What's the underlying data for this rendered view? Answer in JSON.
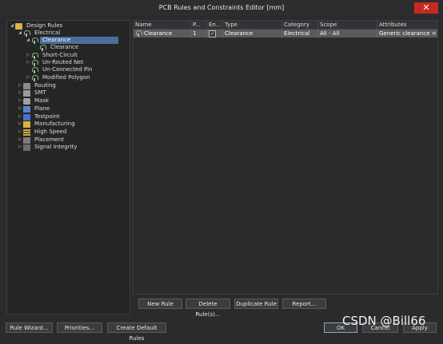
{
  "window": {
    "title": "PCB Rules and Constraints Editor [mm]",
    "close_glyph": "✕"
  },
  "tree": {
    "items": [
      {
        "label": "Design Rules",
        "arrow": "◢"
      },
      {
        "label": "Electrical",
        "arrow": "◢"
      },
      {
        "label": "Clearance",
        "arrow": "◢"
      },
      {
        "label": "Clearance",
        "arrow": ""
      },
      {
        "label": "Short-Circuit",
        "arrow": "▷"
      },
      {
        "label": "Un-Routed Net",
        "arrow": "▷"
      },
      {
        "label": "Un-Connected Pin",
        "arrow": ""
      },
      {
        "label": "Modified Polygon",
        "arrow": "▷"
      },
      {
        "label": "Routing",
        "arrow": "▷"
      },
      {
        "label": "SMT",
        "arrow": "▷"
      },
      {
        "label": "Mask",
        "arrow": "▷"
      },
      {
        "label": "Plane",
        "arrow": "▷"
      },
      {
        "label": "Testpoint",
        "arrow": "▷"
      },
      {
        "label": "Manufacturing",
        "arrow": "▷"
      },
      {
        "label": "High Speed",
        "arrow": "▷"
      },
      {
        "label": "Placement",
        "arrow": "▷"
      },
      {
        "label": "Signal Integrity",
        "arrow": "▷"
      }
    ]
  },
  "table": {
    "headers": [
      "Name",
      "P...",
      "En...",
      "Type",
      "Category",
      "Scope",
      "Attributes"
    ],
    "rows": [
      {
        "name": "Clearance",
        "priority": "1",
        "enabled": "✓",
        "type": "Clearance",
        "category": "Electrical",
        "scope": "All  -  All",
        "attributes": "Generic clearance = 0.2..."
      }
    ]
  },
  "buttons": {
    "new_rule": "New Rule",
    "delete_rule": "Delete Rule(s)...",
    "duplicate_rule": "Duplicate Rule",
    "report": "Report...",
    "rule_wizard": "Rule Wizard...",
    "priorities": "Priorities...",
    "create_default": "Create Default Rules",
    "ok": "OK",
    "cancel": "Cancel",
    "apply": "Apply"
  },
  "watermark": "CSDN @Bill66"
}
